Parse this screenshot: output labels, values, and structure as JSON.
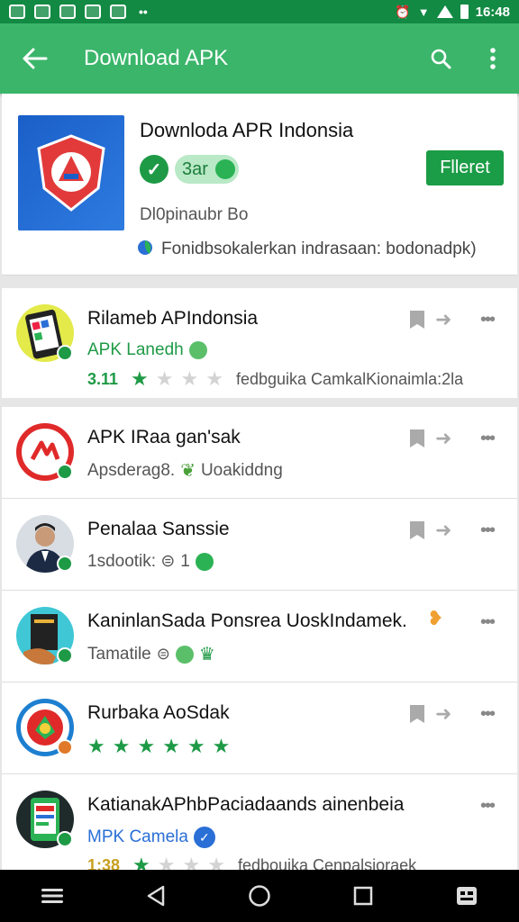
{
  "status_bar": {
    "time": "16:48",
    "dots": "••"
  },
  "app_bar": {
    "title": "Download APK",
    "back_icon": "arrow-left-icon",
    "search_icon": "search-icon",
    "menu_icon": "more-vert-icon"
  },
  "featured": {
    "title": "Downloda APR Indonsia",
    "pill": "3ar",
    "button": "Flleret",
    "meta": "Dl0pinaubr Bo",
    "description": "Fonidbsokalerkan indrasaan: bodonadpk)"
  },
  "list1": [
    {
      "title": "Rilameb APIndonsia",
      "sub": "APK Lanedh",
      "rating": "3.11",
      "stars": 1,
      "meta": "fedbguika CamkalKionaimla:2la"
    }
  ],
  "list2": [
    {
      "title": "APK IRaa gan'sak",
      "sub": "Apsderag8.",
      "sub2": "Uoakiddng"
    },
    {
      "title": "Penalaa Sanssie",
      "sub": "1sdootik: ⊜",
      "sub2": "1"
    },
    {
      "title": "KaninlanSada Ponsrea UoskIndamek.",
      "sub": "Tamatile"
    },
    {
      "title": "Rurbaka AoSdak",
      "stars": 5
    },
    {
      "title": "KatianakAPhbPaciadaands ainenbeia",
      "sub": "MPK Camela",
      "rating": "1:38",
      "stars": 1,
      "meta": "fedbouika Cenpalsioraek"
    }
  ],
  "colors": {
    "status": "#128a43",
    "appbar": "#3bb56a",
    "accent": "#1b9c46"
  }
}
